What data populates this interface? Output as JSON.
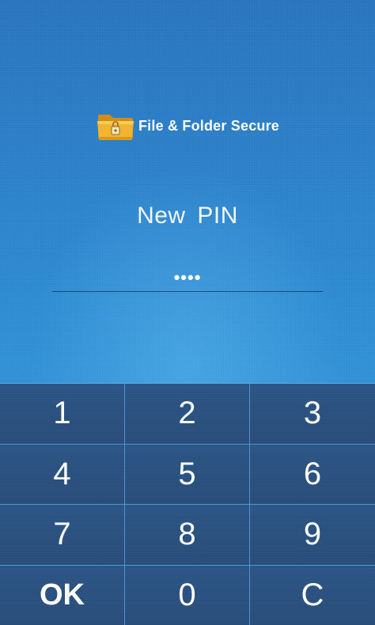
{
  "app": {
    "title": "File & Folder Secure",
    "icon": "lock-folder-icon"
  },
  "prompt": "New  PIN",
  "pin": {
    "masked_value": "••••",
    "length": 4
  },
  "keypad": {
    "keys": [
      "1",
      "2",
      "3",
      "4",
      "5",
      "6",
      "7",
      "8",
      "9",
      "OK",
      "0",
      "C"
    ]
  },
  "colors": {
    "background": "#2e86cd",
    "keypad": "#2a4f78",
    "grid_lines": "#4a95d2",
    "text": "#ffffff",
    "folder": "#f2b431"
  }
}
